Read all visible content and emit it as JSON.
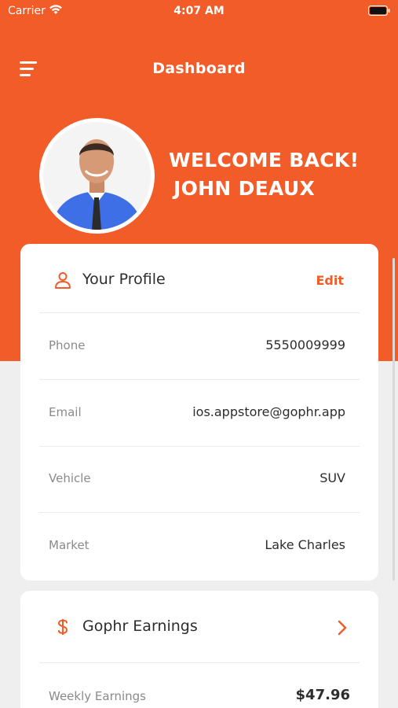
{
  "status_bar": {
    "carrier": "Carrier",
    "time": "4:07 AM"
  },
  "header": {
    "title": "Dashboard",
    "menu_icon": "hamburger-menu-icon"
  },
  "welcome": {
    "greeting": "WELCOME BACK!",
    "name": "JOHN DEAUX"
  },
  "profile": {
    "title": "Your Profile",
    "edit_label": "Edit",
    "icon": "user-icon",
    "rows": [
      {
        "label": "Phone",
        "value": "5550009999"
      },
      {
        "label": "Email",
        "value": "ios.appstore@gophr.app"
      },
      {
        "label": "Vehicle",
        "value": "SUV"
      },
      {
        "label": "Market",
        "value": "Lake Charles"
      }
    ]
  },
  "earnings": {
    "title": "Gophr Earnings",
    "icon": "dollar-icon",
    "weekly_label": "Weekly Earnings",
    "weekly_value": "$47.96"
  },
  "colors": {
    "accent": "#f25c28",
    "background": "#efefef",
    "card": "#ffffff",
    "text_dark": "#2d2d2d",
    "text_muted": "#8a8a8a"
  }
}
